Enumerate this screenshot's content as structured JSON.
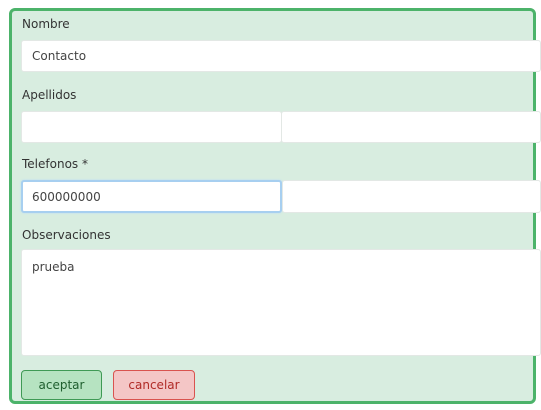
{
  "form": {
    "nombre_label": "Nombre",
    "nombre_value": "Contacto",
    "apellidos_label": "Apellidos",
    "apellido1_value": "",
    "apellido2_value": "",
    "telefonos_label": "Telefonos *",
    "telefono1_value": "600000000",
    "telefono2_value": "",
    "observaciones_label": "Observaciones",
    "observaciones_value": "prueba"
  },
  "actions": {
    "accept_label": "aceptar",
    "cancel_label": "cancelar"
  },
  "colors": {
    "panel_background": "#d8ede0",
    "panel_border": "#4cb36a",
    "accept_border": "#3f9a55",
    "cancel_border": "#d9534f"
  }
}
